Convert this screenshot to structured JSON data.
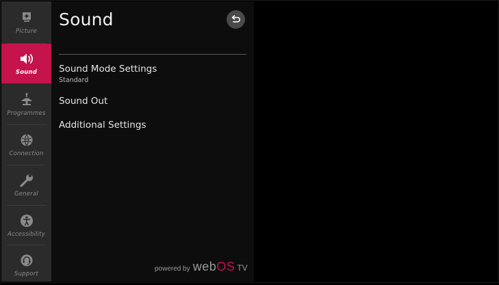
{
  "page": {
    "title": "Sound"
  },
  "sidebar": {
    "items": [
      {
        "label": "Picture",
        "icon": "picture-icon",
        "active": false
      },
      {
        "label": "Sound",
        "icon": "speaker-icon",
        "active": true
      },
      {
        "label": "Programmes",
        "icon": "antenna-icon",
        "active": false
      },
      {
        "label": "Connection",
        "icon": "globe-icon",
        "active": false
      },
      {
        "label": "General",
        "icon": "wrench-icon",
        "active": false
      },
      {
        "label": "Accessibility",
        "icon": "accessibility-icon",
        "active": false
      },
      {
        "label": "Support",
        "icon": "headset-icon",
        "active": false
      }
    ]
  },
  "menu": {
    "items": [
      {
        "label": "Sound Mode Settings",
        "value": "Standard"
      },
      {
        "label": "Sound Out"
      },
      {
        "label": "Additional Settings"
      }
    ]
  },
  "back_button": {
    "icon": "back-arrow-icon"
  },
  "branding": {
    "powered": "powered by",
    "web": "web",
    "os": "OS",
    "tv": "TV"
  },
  "colors": {
    "accent": "#c5134c",
    "sidebar_bg": "#2b2b2b",
    "panel_bg": "#0d0d0d",
    "background": "#000000"
  }
}
